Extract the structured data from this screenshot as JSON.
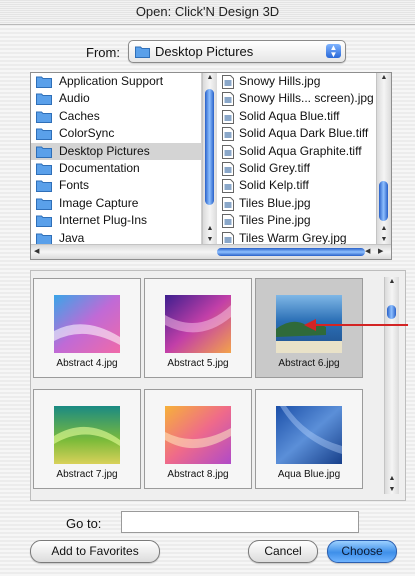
{
  "window": {
    "title": "Open: Click'N Design 3D"
  },
  "from": {
    "label": "From:",
    "value": "Desktop Pictures"
  },
  "browser": {
    "column1": [
      {
        "label": "Application Support"
      },
      {
        "label": "Audio"
      },
      {
        "label": "Caches"
      },
      {
        "label": "ColorSync"
      },
      {
        "label": "Desktop Pictures",
        "selected": true
      },
      {
        "label": "Documentation"
      },
      {
        "label": "Fonts"
      },
      {
        "label": "Image Capture"
      },
      {
        "label": "Internet Plug-Ins"
      },
      {
        "label": "Java"
      }
    ],
    "column2": [
      {
        "label": "Snowy Hills.jpg"
      },
      {
        "label": "Snowy Hills... screen).jpg"
      },
      {
        "label": "Solid Aqua Blue.tiff"
      },
      {
        "label": "Solid Aqua Dark Blue.tiff"
      },
      {
        "label": "Solid Aqua Graphite.tiff"
      },
      {
        "label": "Solid Grey.tiff"
      },
      {
        "label": "Solid Kelp.tiff"
      },
      {
        "label": "Tiles Blue.jpg"
      },
      {
        "label": "Tiles Pine.jpg"
      },
      {
        "label": "Tiles Warm Grey.jpg"
      }
    ]
  },
  "thumbnails": [
    {
      "label": "Abstract 4.jpg",
      "selected": false
    },
    {
      "label": "Abstract 5.jpg",
      "selected": false
    },
    {
      "label": "Abstract 6.jpg",
      "selected": true
    },
    {
      "label": "Abstract 7.jpg",
      "selected": false
    },
    {
      "label": "Abstract 8.jpg",
      "selected": false
    },
    {
      "label": "Aqua Blue.jpg",
      "selected": false
    }
  ],
  "goto": {
    "label": "Go to:",
    "value": ""
  },
  "buttons": {
    "add_to_favorites": "Add to Favorites",
    "cancel": "Cancel",
    "choose": "Choose"
  },
  "colors": {
    "accent": "#3e8fe9",
    "pointer": "#d32424"
  },
  "icons": {
    "folder": "folder-icon",
    "file": "document-icon"
  }
}
